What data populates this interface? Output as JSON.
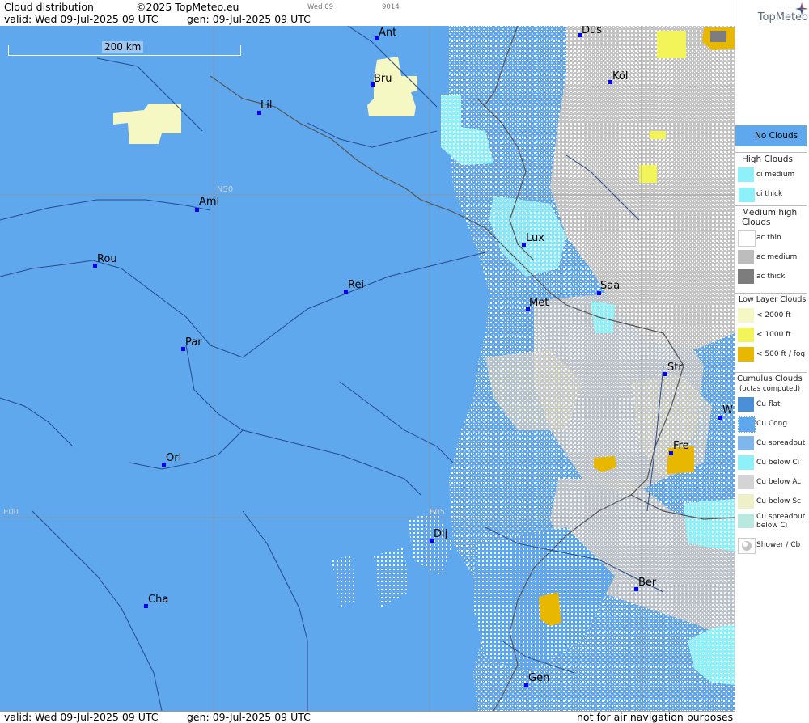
{
  "header": {
    "title": "Cloud distribution",
    "copyright": "©2025 TopMeteo.eu",
    "day_small": "Wed 09",
    "code_small": "9014",
    "valid": "valid:  Wed  09-Jul-2025  09 UTC",
    "gen": "gen: 09-Jul-2025 09 UTC"
  },
  "logo": {
    "text": "TopMeteo"
  },
  "scale": {
    "label": "200 km"
  },
  "grid_labels": {
    "n50": "N50",
    "e00": "E00",
    "e05": "E05"
  },
  "cities": [
    {
      "id": "ant",
      "label": "Ant"
    },
    {
      "id": "dus",
      "label": "Düs"
    },
    {
      "id": "kol",
      "label": "Köl"
    },
    {
      "id": "bru",
      "label": "Bru"
    },
    {
      "id": "lil",
      "label": "Lil"
    },
    {
      "id": "ami",
      "label": "Ami"
    },
    {
      "id": "rou",
      "label": "Rou"
    },
    {
      "id": "lux",
      "label": "Lux"
    },
    {
      "id": "rei",
      "label": "Rei"
    },
    {
      "id": "saa",
      "label": "Saa"
    },
    {
      "id": "met",
      "label": "Met"
    },
    {
      "id": "par",
      "label": "Par"
    },
    {
      "id": "str",
      "label": "Str"
    },
    {
      "id": "w",
      "label": "W"
    },
    {
      "id": "fre",
      "label": "Fre"
    },
    {
      "id": "orl",
      "label": "Orl"
    },
    {
      "id": "dij",
      "label": "Dij"
    },
    {
      "id": "ber",
      "label": "Ber"
    },
    {
      "id": "cha",
      "label": "Cha"
    },
    {
      "id": "gen",
      "label": "Gen"
    }
  ],
  "footer": {
    "valid": "valid:  Wed  09-Jul-2025  09 UTC",
    "gen": "gen: 09-Jul-2025 09 UTC",
    "note": "not for air navigation purposes"
  },
  "legend": {
    "no_clouds": "No Clouds",
    "high_title": "High Clouds",
    "ci_medium": "ci medium",
    "ci_thick": "ci thick",
    "medium_title_1": "Medium high",
    "medium_title_2": "Clouds",
    "ac_thin": "ac thin",
    "ac_medium": "ac medium",
    "ac_thick": "ac thick",
    "low_title": "Low Layer Clouds",
    "lt2000": "< 2000 ft",
    "lt1000": "< 1000 ft",
    "lt500": "< 500 ft / fog",
    "cu_title_1": "Cumulus Clouds",
    "cu_title_2": "(octas computed)",
    "cu_flat": "Cu flat",
    "cu_cong": "Cu Cong",
    "cu_spread": "Cu spreadout",
    "cu_below_ci": "Cu below Ci",
    "cu_below_ac": "Cu below Ac",
    "cu_below_sc": "Cu below Sc",
    "cu_spread_ci_1": "Cu spreadout",
    "cu_spread_ci_2": "below Ci",
    "shower": "Shower / Cb"
  },
  "colors": {
    "no_clouds": "#5fa8ee",
    "ci": "#8ef0f8",
    "ac_thin": "#ffffff",
    "ac_medium": "#bdbdbd",
    "ac_thick": "#7d7d7d",
    "low_2000": "#f6f8c4",
    "low_1000": "#f3f35a",
    "low_500": "#e8b800",
    "city_dot": "#0000ff"
  }
}
